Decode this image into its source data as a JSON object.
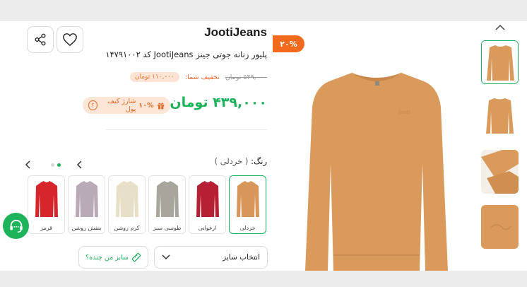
{
  "product": {
    "brand": "JootiJeans",
    "title": "پلیور زنانه جوتی جینز JootiJeans کد ۱۴۷۹۱۰۰۲",
    "old_price": "۵۴۹,۰۰۰ تومان",
    "discount_label": "تخفیف شما:",
    "discount_amount": "۱۱۰,۰۰۰ تومان",
    "price": "۴۳۹,۰۰۰ تومان",
    "discount_badge": "۲۰%"
  },
  "wallet": {
    "percent": "۱۰%",
    "text": "شارژ کیف پول",
    "question": "؟"
  },
  "colors": {
    "label": "رنگ:",
    "selected": "( خردلی )",
    "options": [
      {
        "name": "خردلی",
        "hex": "#d7975b"
      },
      {
        "name": "ارغوانی",
        "hex": "#b61f34"
      },
      {
        "name": "طوسی سبز",
        "hex": "#a8a69c"
      },
      {
        "name": "کرم روشن",
        "hex": "#e8dfc9"
      },
      {
        "name": "بنفش روشن",
        "hex": "#b9aab8"
      },
      {
        "name": "قرمز",
        "hex": "#d6252b"
      }
    ]
  },
  "size": {
    "select_label": "انتخاب سایز",
    "guide_label": "سایز من چنده؟"
  },
  "accent": "#1db35b",
  "badge_color": "#f26a1e"
}
